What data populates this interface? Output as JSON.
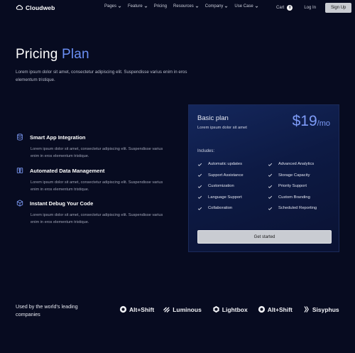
{
  "nav": {
    "brand": "Cloudweb",
    "menu": [
      {
        "label": "Pages",
        "dropdown": true
      },
      {
        "label": "Feature",
        "dropdown": true
      },
      {
        "label": "Pricing",
        "dropdown": false
      },
      {
        "label": "Resources",
        "dropdown": true
      },
      {
        "label": "Company",
        "dropdown": true
      },
      {
        "label": "Use Case",
        "dropdown": true
      }
    ],
    "cart_label": "Cart",
    "cart_count": "0",
    "login_label": "Log In",
    "signup_label": "Sign Up"
  },
  "hero": {
    "title_main": "Pricing",
    "title_accent": "Plan",
    "description": "Lorem ipsum dolor sit amet, consectetur adipiscing elit. Suspendisse varius enim in eros elementum tristique."
  },
  "features": [
    {
      "icon": "database-icon",
      "title": "Smart App Integration",
      "description": "Lorem ipsum dolor sit amet, consectetur adipiscing elit. Suspendisse varius enim in eros elementum tristique."
    },
    {
      "icon": "book-icon",
      "title": "Automated Data Management",
      "description": "Lorem ipsum dolor sit amet, consectetur adipiscing elit. Suspendisse varius enim in eros elementum tristique."
    },
    {
      "icon": "cube-icon",
      "title": "Instant Debug Your Code",
      "description": "Lorem ipsum dolor sit amet, consectetur adipiscing elit. Suspendisse varius enim in eros elementum tristique."
    }
  ],
  "plan": {
    "name": "Basic plan",
    "subtitle": "Lorem ipsum dolor sit amet",
    "price": "$19",
    "period": "/mo",
    "includes_label": "Includes:",
    "features": [
      "Automatic updates",
      "Advanced Analytics",
      "Support Assistance",
      "Storage Capacity",
      "Customization",
      "Priority Support",
      "Language Support",
      "Custom Branding",
      "Collaboration",
      "Scheduled Reporting"
    ],
    "cta_label": "Get started"
  },
  "logos": {
    "heading": "Used by the world's leading companies",
    "brands": [
      {
        "name": "Alt+Shift",
        "icon": "altshift-logo-icon"
      },
      {
        "name": "Luminous",
        "icon": "luminous-logo-icon"
      },
      {
        "name": "Lightbox",
        "icon": "lightbox-logo-icon"
      },
      {
        "name": "Alt+Shift",
        "icon": "altshift-logo-icon"
      },
      {
        "name": "Sisyphus",
        "icon": "sisyphus-logo-icon"
      }
    ]
  },
  "colors": {
    "background": "#070b20",
    "accent": "#6b8ff5",
    "card_gradient_top": "#14275c",
    "button": "#c9ccd2"
  }
}
